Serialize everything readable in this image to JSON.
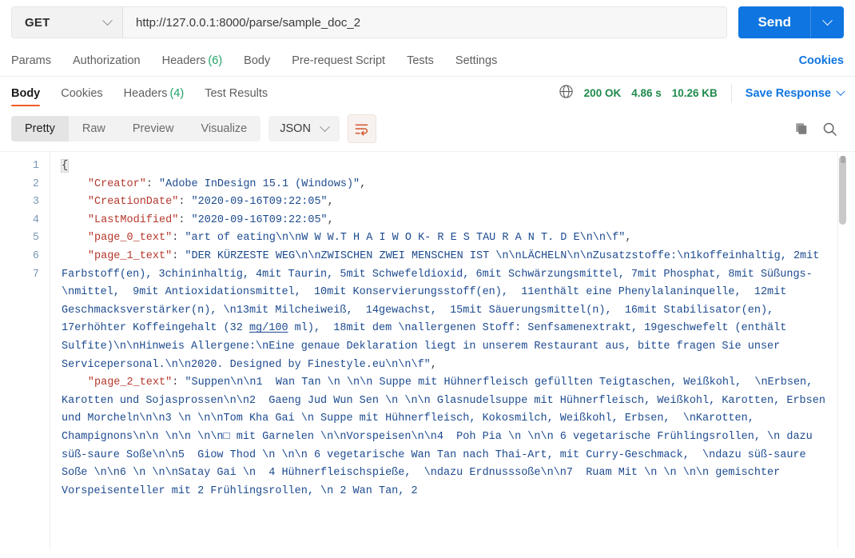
{
  "request": {
    "method": "GET",
    "method_icon": "chevron-down-icon",
    "url": "http://127.0.0.1:8000/parse/sample_doc_2",
    "url_placeholder": "Enter request URL",
    "send_label": "Send",
    "send_caret_icon": "chevron-down-icon",
    "accent_blue": "#0f75e0"
  },
  "request_tabs": {
    "items": [
      {
        "label": "Params",
        "count": ""
      },
      {
        "label": "Authorization",
        "count": ""
      },
      {
        "label": "Headers",
        "count": "(6)"
      },
      {
        "label": "Body",
        "count": ""
      },
      {
        "label": "Pre-request Script",
        "count": ""
      },
      {
        "label": "Tests",
        "count": ""
      },
      {
        "label": "Settings",
        "count": ""
      }
    ],
    "cookies_label": "Cookies"
  },
  "response_tabs": {
    "items": [
      {
        "label": "Body",
        "count": "",
        "active": true
      },
      {
        "label": "Cookies",
        "count": "",
        "active": false
      },
      {
        "label": "Headers",
        "count": "(4)",
        "active": false
      },
      {
        "label": "Test Results",
        "count": "",
        "active": false
      }
    ],
    "active_underline_color": "#ef5b25",
    "globe_icon": "globe-icon",
    "status": "200 OK",
    "time": "4.86 s",
    "size": "10.26 KB",
    "status_color": "#1f8a4c",
    "save_response_label": "Save Response",
    "save_response_caret_icon": "chevron-down-icon"
  },
  "body_toolbar": {
    "view_modes": [
      {
        "label": "Pretty",
        "active": true
      },
      {
        "label": "Raw",
        "active": false
      },
      {
        "label": "Preview",
        "active": false
      },
      {
        "label": "Visualize",
        "active": false
      }
    ],
    "format": "JSON",
    "format_caret_icon": "chevron-down-icon",
    "wrap_icon": "word-wrap-icon",
    "wrap_active_color": "#d4603a",
    "copy_icon": "copy-icon",
    "search_icon": "search-icon"
  },
  "code": {
    "line_numbers": [
      "1",
      "2",
      "3",
      "4",
      "5",
      "6",
      "7"
    ],
    "lines": [
      {
        "n": "1",
        "indent": 0,
        "tokens": [
          {
            "t": "brace-open",
            "v": "{"
          }
        ]
      },
      {
        "n": "2",
        "indent": 1,
        "key": "\"Creator\"",
        "sep": ": ",
        "value": "\"Adobe InDesign 15.1 (Windows)\"",
        "comma": ","
      },
      {
        "n": "3",
        "indent": 1,
        "key": "\"CreationDate\"",
        "sep": ": ",
        "value": "\"2020-09-16T09:22:05\"",
        "comma": ","
      },
      {
        "n": "4",
        "indent": 1,
        "key": "\"LastModified\"",
        "sep": ": ",
        "value": "\"2020-09-16T09:22:05\"",
        "comma": ","
      },
      {
        "n": "5",
        "indent": 1,
        "key": "\"page_0_text\"",
        "sep": ": ",
        "value": "\"art of eating\\n\\nW W W.T H A I W O K- R E S TAU R A N T. D E\\n\\n\\f\"",
        "comma": ","
      },
      {
        "n": "6",
        "indent": 1,
        "key": "\"page_1_text\"",
        "sep": ": ",
        "value": "\"DER KÜRZESTE WEG\\n\\nZWISCHEN ZWEI MENSCHEN IST \\n\\nLÄCHELN\\n\\nZusatzstoffe:\\n1koffeinhaltig, 2mit Farbstoff(en), 3chininhaltig, 4mit Taurin, 5mit Schwefeldioxid, 6mit Schwärzungsmittel, 7mit Phosphat, 8mit Süßungs-\\nmittel,  9mit Antioxidationsmittel,  10mit Konservierungsstoff(en),  11enthält eine Phenylalaninquelle,  12mit Geschmacksverstärker(n), \\n13mit Milcheiweiß,  14gewachst,  15mit Säuerungsmittel(n),  16mit Stabilisator(en),  17erhöhter Koffeingehalt (32 mg/100 ml),  18mit dem \\nallergenen Stoff: Senfsamenextrakt, 19geschwefelt (enthält Sulfite)\\n\\nHinweis Allergene:\\nEine genaue Deklaration liegt in unserem Restaurant aus, bitte fragen Sie unser Servicepersonal.\\n\\n2020. Designed by Finestyle.eu\\n\\n\\f\"",
        "comma": ","
      },
      {
        "n": "7",
        "indent": 1,
        "key": "\"page_2_text\"",
        "sep": ": ",
        "value": "\"Suppen\\n\\n1  Wan Tan \\n \\n\\n Suppe mit Hühnerfleisch gefüllten Teigtaschen, Weißkohl,  \\nErbsen, Karotten und Sojasprossen\\n\\n2  Gaeng Jud Wun Sen \\n \\n\\n Glasnudelsuppe mit Hühnerfleisch, Weißkohl, Karotten, Erbsen und Morcheln\\n\\n3 \\n \\n\\nTom Kha Gai \\n Suppe mit Hühnerfleisch, Kokosmilch, Weißkohl, Erbsen,  \\nKarotten, Champignons\\n\\n \\n\\n \\n\\n□ mit Garnelen \\n\\nVorspeisen\\n\\n4  Poh Pia \\n \\n\\n 6 vegetarische Frühlingsrollen, \\n dazu süß-saure Soße\\n\\n5  Giow Thod \\n \\n\\n 6 vegetarische Wan Tan nach Thai-Art, mit Curry-Geschmack,  \\ndazu süß-saure Soße \\n\\n6 \\n \\n\\nSatay Gai \\n  4 Hühnerfleischspieße,  \\ndazu Erdnusssoße\\n\\n7  Ruam Mit \\n \\n \\n\\n gemischter Vorspeisenteller mit 2 Frühlingsrollen, \\n 2 Wan Tan, 2",
        "comma": ""
      }
    ],
    "link_token": "mg/100",
    "key_color": "#b5382c",
    "string_color": "#1d4b8f",
    "gutter_color": "#7b98b5"
  },
  "scrollbar": {
    "name": "response-scrollbar"
  }
}
